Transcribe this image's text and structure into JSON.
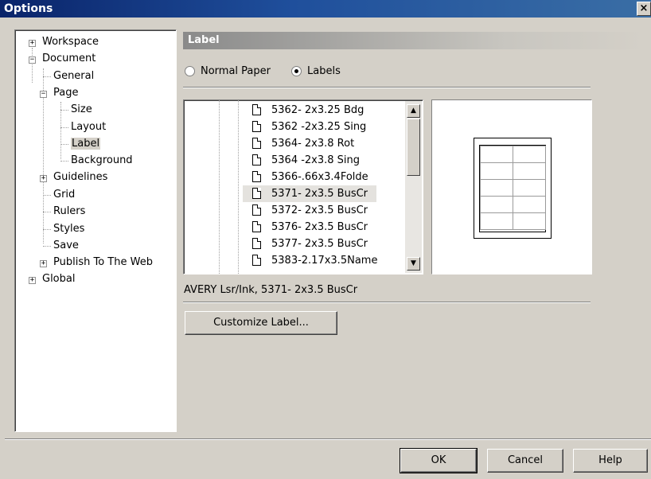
{
  "window": {
    "title": "Options",
    "close": "×"
  },
  "tree": {
    "workspace": "Workspace",
    "document": "Document",
    "general": "General",
    "page": "Page",
    "size": "Size",
    "layout": "Layout",
    "label": "Label",
    "background": "Background",
    "guidelines": "Guidelines",
    "grid": "Grid",
    "rulers": "Rulers",
    "styles": "Styles",
    "save": "Save",
    "publish": "Publish To The Web",
    "global": "Global"
  },
  "panel": {
    "title": "Label"
  },
  "paper": {
    "normal_label": "Normal Paper",
    "labels_label": "Labels",
    "selected": "Labels"
  },
  "label_list": {
    "items": [
      "5362- 2x3.25 Bdg",
      "5362 -2x3.25 Sing",
      "5364- 2x3.8 Rot",
      "5364 -2x3.8 Sing",
      "5366-.66x3.4Folde",
      "5371- 2x3.5 BusCr",
      "5372- 2x3.5 BusCr",
      "5376- 2x3.5 BusCr",
      "5377- 2x3.5 BusCr",
      "5383-2.17x3.5Name"
    ],
    "selected_index": 5
  },
  "selected_description": "AVERY Lsr/Ink, 5371- 2x3.5 BusCr",
  "customize_button": "Customize Label...",
  "footer": {
    "ok": "OK",
    "cancel": "Cancel",
    "help": "Help"
  },
  "icons": {
    "expand": "plus-box",
    "collapse": "minus-box",
    "label_item": "document-page-icon"
  }
}
